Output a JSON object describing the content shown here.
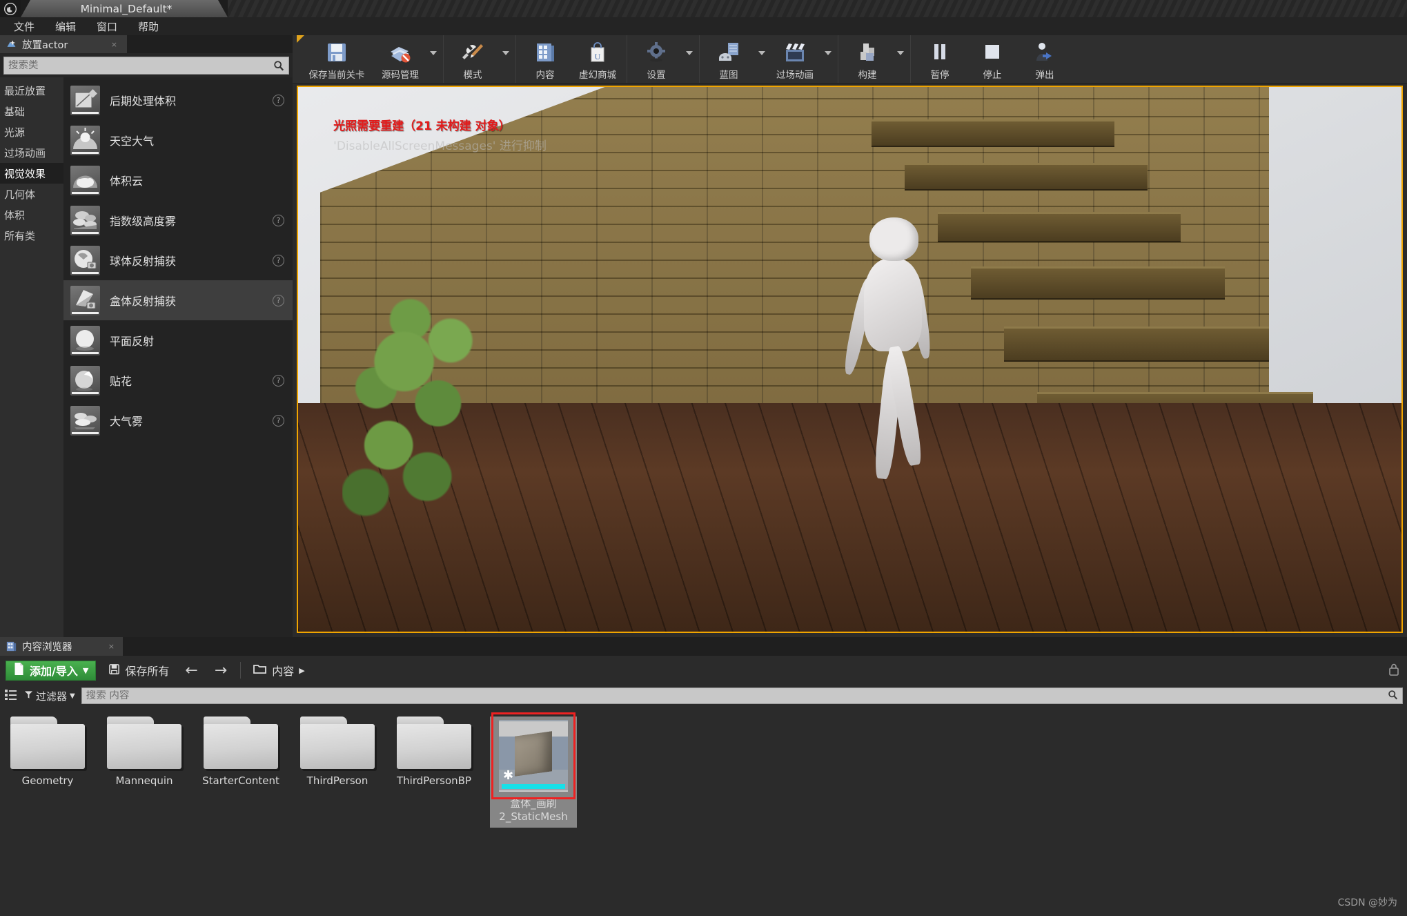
{
  "titlebar": {
    "project_tab": "Minimal_Default*",
    "logo_icon": "unreal-engine-logo"
  },
  "menubar": {
    "items": [
      "文件",
      "编辑",
      "窗口",
      "帮助"
    ]
  },
  "place_actors": {
    "tab_label": "放置actor",
    "tab_icon": "place-actors-icon",
    "tab_close": "×",
    "search": {
      "placeholder": "搜索类",
      "value": "",
      "icon": "search-icon"
    },
    "categories": [
      {
        "label": "最近放置",
        "active": false
      },
      {
        "label": "基础",
        "active": false
      },
      {
        "label": "光源",
        "active": false
      },
      {
        "label": "过场动画",
        "active": false
      },
      {
        "label": "视觉效果",
        "active": true
      },
      {
        "label": "几何体",
        "active": false
      },
      {
        "label": "体积",
        "active": false
      },
      {
        "label": "所有类",
        "active": false
      }
    ],
    "items": [
      {
        "label": "后期处理体积",
        "icon": "post-process-volume-icon",
        "help": true,
        "selected": false
      },
      {
        "label": "天空大气",
        "icon": "sky-atmosphere-icon",
        "help": false,
        "selected": false
      },
      {
        "label": "体积云",
        "icon": "volumetric-cloud-icon",
        "help": false,
        "selected": false
      },
      {
        "label": "指数级高度雾",
        "icon": "exponential-height-fog-icon",
        "help": true,
        "selected": false
      },
      {
        "label": "球体反射捕获",
        "icon": "sphere-reflection-capture-icon",
        "help": true,
        "selected": false
      },
      {
        "label": "盒体反射捕获",
        "icon": "box-reflection-capture-icon",
        "help": true,
        "selected": true
      },
      {
        "label": "平面反射",
        "icon": "planar-reflection-icon",
        "help": false,
        "selected": false
      },
      {
        "label": "贴花",
        "icon": "decal-icon",
        "help": true,
        "selected": false
      },
      {
        "label": "大气雾",
        "icon": "atmospheric-fog-icon",
        "help": true,
        "selected": false
      }
    ],
    "help_glyph": "?"
  },
  "toolbar": {
    "groups": [
      {
        "buttons": [
          {
            "label": "保存当前关卡",
            "icon": "save-level-icon",
            "dropdown": false,
            "wide": true
          },
          {
            "label": "源码管理",
            "icon": "source-control-icon",
            "dropdown": true
          }
        ]
      },
      {
        "buttons": [
          {
            "label": "模式",
            "icon": "modes-icon",
            "dropdown": true
          }
        ]
      },
      {
        "buttons": [
          {
            "label": "内容",
            "icon": "content-icon",
            "dropdown": false
          },
          {
            "label": "虚幻商城",
            "icon": "marketplace-icon",
            "dropdown": false
          }
        ]
      },
      {
        "buttons": [
          {
            "label": "设置",
            "icon": "settings-gear-icon",
            "dropdown": true
          }
        ]
      },
      {
        "buttons": [
          {
            "label": "蓝图",
            "icon": "blueprint-icon",
            "dropdown": true
          },
          {
            "label": "过场动画",
            "icon": "cinematics-clapper-icon",
            "dropdown": true
          }
        ]
      },
      {
        "buttons": [
          {
            "label": "构建",
            "icon": "build-icon",
            "dropdown": true
          }
        ]
      },
      {
        "buttons": [
          {
            "label": "暂停",
            "icon": "pause-icon",
            "dropdown": false
          },
          {
            "label": "停止",
            "icon": "stop-icon",
            "dropdown": false
          },
          {
            "label": "弹出",
            "icon": "eject-icon",
            "dropdown": false
          }
        ]
      }
    ]
  },
  "viewport": {
    "warning_line1": "光照需要重建（21 未构建 对象）",
    "warning_line2": "'DisableAllScreenMessages' 进行抑制",
    "border_color": "#f0a500",
    "warning_color": "#e21b1b"
  },
  "content_browser": {
    "tab_label": "内容浏览器",
    "tab_icon": "content-browser-icon",
    "tab_close": "×",
    "add_import_label": "添加/导入",
    "add_import_icon": "add-file-icon",
    "add_import_caret": "▼",
    "save_all_label": "保存所有",
    "save_all_icon": "save-icon",
    "back_arrow": "←",
    "forward_arrow": "→",
    "path_folder_icon": "folder-open-icon",
    "path_label": "内容",
    "path_caret": "▶",
    "lock_icon": "lock-icon",
    "view_options_icon": "view-options-icon",
    "filter_icon": "filter-funnel-icon",
    "filter_label": "过滤器",
    "filter_caret": "▼",
    "search": {
      "placeholder": "搜索 内容",
      "value": "",
      "icon": "search-icon"
    },
    "assets": [
      {
        "name": "Geometry",
        "type": "folder"
      },
      {
        "name": "Mannequin",
        "type": "folder"
      },
      {
        "name": "StarterContent",
        "type": "folder"
      },
      {
        "name": "ThirdPerson",
        "type": "folder"
      },
      {
        "name": "ThirdPersonBP",
        "type": "folder"
      },
      {
        "name": "盒体_画刷2_StaticMesh",
        "type": "static-mesh",
        "selected": true,
        "highlight_color": "#ee2222"
      }
    ]
  },
  "watermark": "CSDN @妙为"
}
